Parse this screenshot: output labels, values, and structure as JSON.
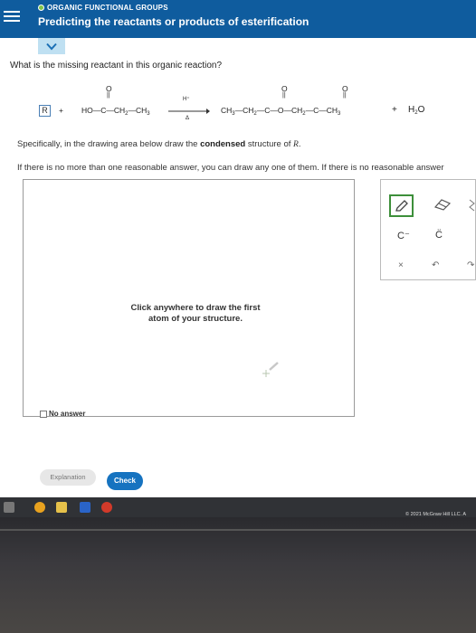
{
  "header": {
    "category": "ORGANIC FUNCTIONAL GROUPS",
    "title": "Predicting the reactants or products of esterification"
  },
  "question": "What is the missing reactant in this organic reaction?",
  "reaction": {
    "unknown": "R",
    "plus1": "+",
    "reactant2_left": "HO",
    "carbonyl_o": "O",
    "reactant2_rest": "C—CH",
    "reactant2_sub1": "2",
    "reactant2_end": "—CH",
    "reactant2_sub2": "3",
    "catalyst": "H⁺",
    "heat": "Δ",
    "product_a": "CH",
    "product_a_sub": "3",
    "product_b": "—CH",
    "product_b_sub": "2",
    "product_c": "—C—O—CH",
    "product_c_sub": "2",
    "product_d": "—C—CH",
    "product_d_sub": "3",
    "product_o1": "O",
    "product_o2": "O",
    "plus2": "+",
    "water": "H",
    "water_sub": "2",
    "water_end": "O"
  },
  "instruction": {
    "prefix": "Specifically, in the drawing area below draw the ",
    "bold": "condensed",
    "suffix": " structure of ",
    "variable": "R",
    "end": ".",
    "line2": "If there is no more than one reasonable answer, you can draw any one of them. If there is no reasonable answer"
  },
  "draw_area": {
    "hint_line1": "Click anywhere to draw the first",
    "hint_line2": "atom of your structure.",
    "no_answer_label": "No answer"
  },
  "palette": {
    "carbanion": "C⁻",
    "radical": "C̈",
    "clear_icon": "×",
    "undo_icon": "↶",
    "redo_icon": "↷"
  },
  "buttons": {
    "explanation": "Explanation",
    "check": "Check"
  },
  "footer": {
    "copyright": "© 2021 McGraw Hill LLC. A"
  },
  "colors": {
    "header_bg": "#0f5c9e",
    "accent_green": "#3d8f3a",
    "check_button": "#1673c0"
  }
}
